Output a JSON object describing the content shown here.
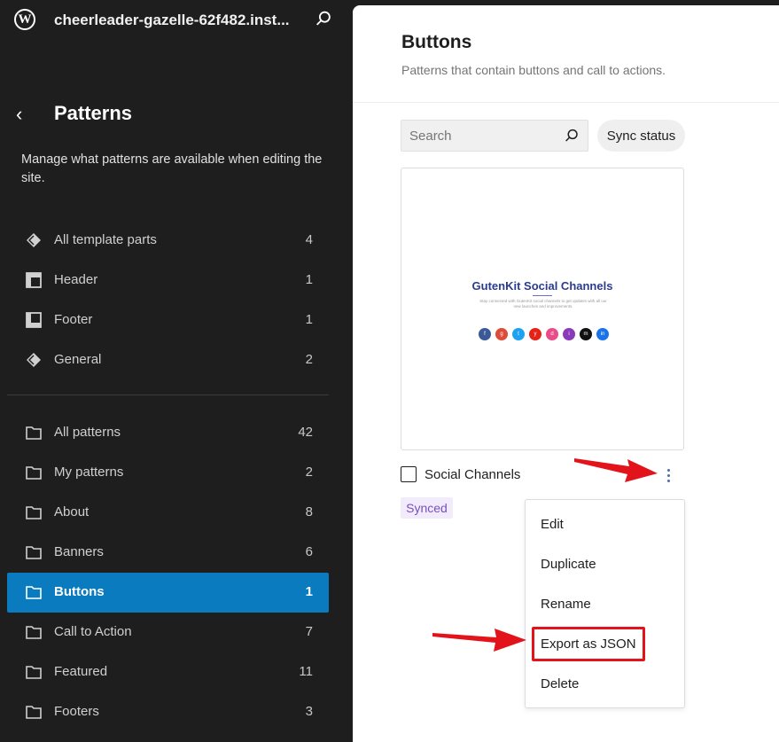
{
  "topbar": {
    "logo_icon": "wordpress-logo-icon",
    "site_title": "cheerleader-gazelle-62f482.inst...",
    "search_icon": "search-icon"
  },
  "sidebar": {
    "back_icon": "chevron-left-icon",
    "title": "Patterns",
    "description": "Manage what patterns are available when editing the site.",
    "template_parts": [
      {
        "icon": "diamond-icon",
        "label": "All template parts",
        "count": "4"
      },
      {
        "icon": "header-layout-icon",
        "label": "Header",
        "count": "1"
      },
      {
        "icon": "footer-layout-icon",
        "label": "Footer",
        "count": "1"
      },
      {
        "icon": "diamond-icon",
        "label": "General",
        "count": "2"
      }
    ],
    "categories": [
      {
        "icon": "folder-icon",
        "label": "All patterns",
        "count": "42"
      },
      {
        "icon": "folder-icon",
        "label": "My patterns",
        "count": "2"
      },
      {
        "icon": "folder-icon",
        "label": "About",
        "count": "8"
      },
      {
        "icon": "folder-icon",
        "label": "Banners",
        "count": "6"
      },
      {
        "icon": "folder-icon",
        "label": "Buttons",
        "count": "1"
      },
      {
        "icon": "folder-icon",
        "label": "Call to Action",
        "count": "7"
      },
      {
        "icon": "folder-icon",
        "label": "Featured",
        "count": "11"
      },
      {
        "icon": "folder-icon",
        "label": "Footers",
        "count": "3"
      }
    ],
    "active_category": "Buttons",
    "active_color": "#0a7bbf"
  },
  "main": {
    "title": "Buttons",
    "subtitle": "Patterns that contain buttons and call to actions.",
    "search": {
      "placeholder": "Search",
      "icon": "search-icon"
    },
    "sync_status_label": "Sync status",
    "pattern": {
      "preview": {
        "heading": "GutenKit Social Channels",
        "text": "Stay connected with GutenKit social channels to get updates with all our new launches and improvements.",
        "social_icons": [
          {
            "name": "facebook-icon",
            "glyph": "f",
            "color": "#3b5998"
          },
          {
            "name": "google-plus-icon",
            "glyph": "g",
            "color": "#dd4b39"
          },
          {
            "name": "twitter-icon",
            "glyph": "t",
            "color": "#1da1f2"
          },
          {
            "name": "youtube-icon",
            "glyph": "y",
            "color": "#e62117"
          },
          {
            "name": "dribbble-icon",
            "glyph": "d",
            "color": "#ea4c89"
          },
          {
            "name": "instagram-icon",
            "glyph": "i",
            "color": "#8a3ab9"
          },
          {
            "name": "medium-icon",
            "glyph": "m",
            "color": "#111111"
          },
          {
            "name": "linkedin-icon",
            "glyph": "in",
            "color": "#1a73e8"
          }
        ]
      },
      "title": "Social Channels",
      "badge": "Synced",
      "menu_icon": "more-vertical-icon"
    },
    "menu": {
      "items": [
        "Edit",
        "Duplicate",
        "Rename",
        "Export as JSON",
        "Delete"
      ],
      "highlighted_item": "Export as JSON",
      "highlight_color": "#e3131c"
    }
  }
}
